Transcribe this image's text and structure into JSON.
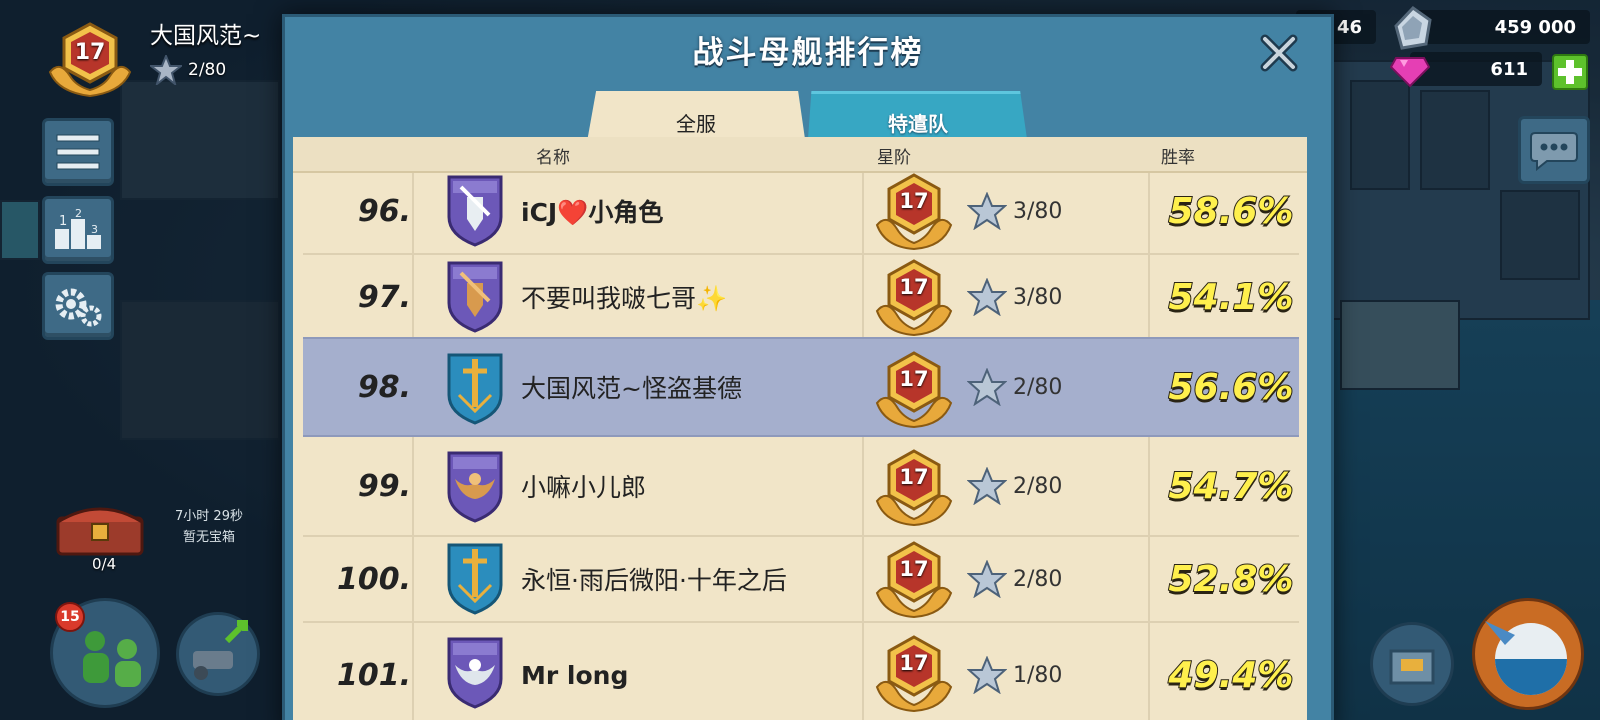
{
  "hud": {
    "player_level": "17",
    "player_name": "大国风范~",
    "stars": "2/80",
    "resources": {
      "iron": "459 000",
      "diamonds": "611",
      "partial_value": "46"
    },
    "chest": {
      "timer": "7小时 29秒",
      "status": "暂无宝箱",
      "count": "0/4"
    },
    "troop_badge": "15"
  },
  "modal": {
    "title": "战斗母舰排行榜",
    "tabs": [
      {
        "label": "全服",
        "active": true
      },
      {
        "label": "特遣队",
        "active": false
      }
    ],
    "columns": {
      "name": "名称",
      "star_level": "星阶",
      "win_rate": "胜率"
    },
    "rows": [
      {
        "rank": "96.",
        "name": "iCJ❤️小角色",
        "level": "17",
        "stars": "3/80",
        "win_rate": "58.6%",
        "shield": "purple-fist",
        "highlight": false
      },
      {
        "rank": "97.",
        "name": "不要叫我啵七哥✨",
        "level": "17",
        "stars": "3/80",
        "win_rate": "54.1%",
        "shield": "purple-gold-fist",
        "highlight": false
      },
      {
        "rank": "98.",
        "name": "大国风范~怪盗基德",
        "level": "17",
        "stars": "2/80",
        "win_rate": "56.6%",
        "shield": "blue-sword",
        "highlight": true
      },
      {
        "rank": "99.",
        "name": "小嘛小儿郎",
        "level": "17",
        "stars": "2/80",
        "win_rate": "54.7%",
        "shield": "purple-wings",
        "highlight": false
      },
      {
        "rank": "100.",
        "name": "永恒·雨后微阳·十年之后",
        "level": "17",
        "stars": "2/80",
        "win_rate": "52.8%",
        "shield": "blue-sword",
        "highlight": false
      },
      {
        "rank": "101.",
        "name": "Mr long",
        "level": "17",
        "stars": "1/80",
        "win_rate": "49.4%",
        "shield": "purple-silver-wings",
        "highlight": false
      }
    ]
  },
  "colors": {
    "modal_blue": "#4383a4",
    "parchment": "#f1e5c8",
    "highlight_row": "#a5afcd",
    "win_rate_yellow": "#fff04d",
    "level_gold": "#e2a13a",
    "level_red": "#b7352a"
  }
}
